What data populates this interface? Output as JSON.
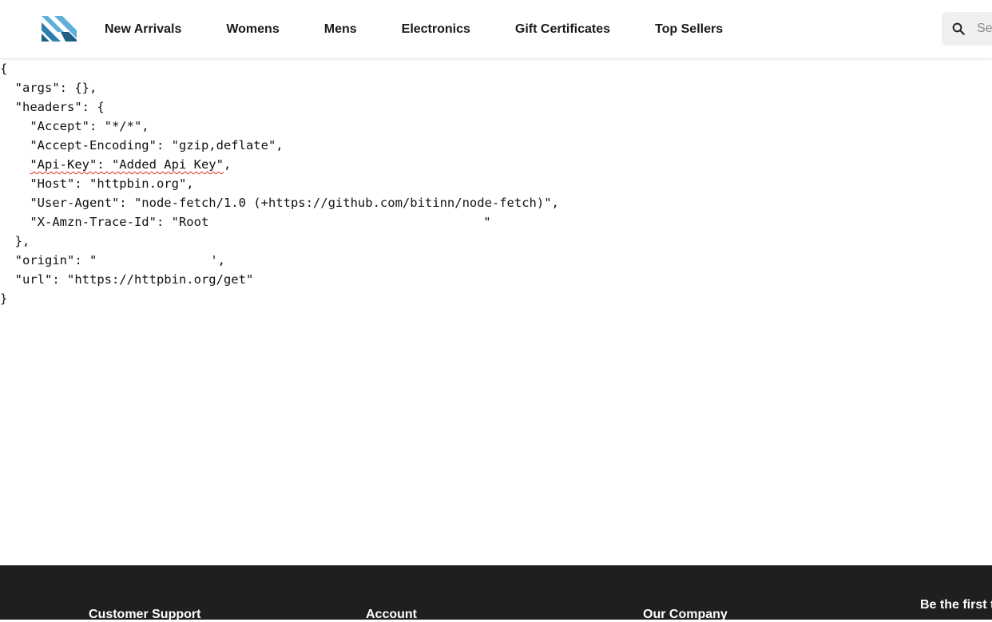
{
  "header": {
    "logo_name": "brand-logo",
    "nav": [
      {
        "label": "New Arrivals"
      },
      {
        "label": "Womens"
      },
      {
        "label": "Mens"
      },
      {
        "label": "Electronics"
      },
      {
        "label": "Gift Certificates"
      },
      {
        "label": "Top Sellers"
      }
    ],
    "search": {
      "placeholder": "Se"
    }
  },
  "json_lines": {
    "l0": "{",
    "l1": "  \"args\": {},",
    "l2": "  \"headers\": {",
    "l3": "    \"Accept\": \"*/*\",",
    "l4": "    \"Accept-Encoding\": \"gzip,deflate\",",
    "l5_pre": "    ",
    "l5_key": "\"Api-Key\": \"Added Api Key\"",
    "l5_post": ",",
    "l6": "    \"Host\": \"httpbin.org\",",
    "l7": "    \"User-Agent\": \"node-fetch/1.0 (+https://github.com/bitinn/node-fetch)\",",
    "l8_pre": "    \"X-Amzn-Trace-Id\": \"Root",
    "l8_post": "\"",
    "l9": "  },",
    "l10_pre": "  \"origin\": \"",
    "l10_post": "',",
    "l11": "  \"url\": \"https://httpbin.org/get\"",
    "l12": "}"
  },
  "footer": {
    "columns": [
      {
        "title": "Customer Support"
      },
      {
        "title": "Account"
      },
      {
        "title": "Our Company"
      }
    ],
    "newsletter": "Be the first t"
  },
  "colors": {
    "accent_logo_light": "#5fb0d9",
    "accent_logo_dark": "#1f5f86",
    "footer_bg": "#1f1f1f",
    "spell_error": "#d93025"
  }
}
